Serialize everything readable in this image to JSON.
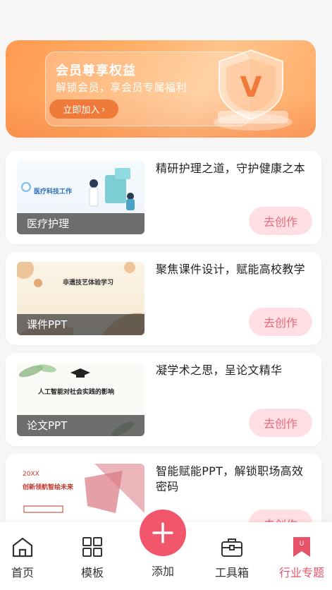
{
  "banner": {
    "title": "会员尊享权益",
    "subtitle": "解锁会员，享会员专属福利",
    "join_label": "立即加入",
    "badge_letter": "V"
  },
  "cards": [
    {
      "thumb_title": "医疗科技工作",
      "thumb_label": "医疗护理",
      "description": "精研护理之道，守护健康之本",
      "button_label": "去创作"
    },
    {
      "thumb_title": "非遗技艺体验学习",
      "thumb_label": "课件PPT",
      "description": "聚焦课件设计，赋能高校教学",
      "button_label": "去创作"
    },
    {
      "thumb_title": "人工智能对社会实践的影响",
      "thumb_label": "论文PPT",
      "description": "凝学术之思，呈论文精华",
      "button_label": "去创作"
    },
    {
      "thumb_title_1": "20XX",
      "thumb_title_2": "创新领航智绘未来",
      "description": "智能赋能PPT，解锁职场高效密码",
      "button_label": "去创作"
    }
  ],
  "nav": {
    "home": "首页",
    "templates": "模板",
    "add": "添加",
    "toolbox": "工具箱",
    "industry": "行业专题",
    "active": "industry"
  },
  "colors": {
    "accent": "#f2566c",
    "banner_orange": "#ff9a52",
    "button_bg": "#ffdfe3",
    "button_text": "#e56b7c"
  }
}
